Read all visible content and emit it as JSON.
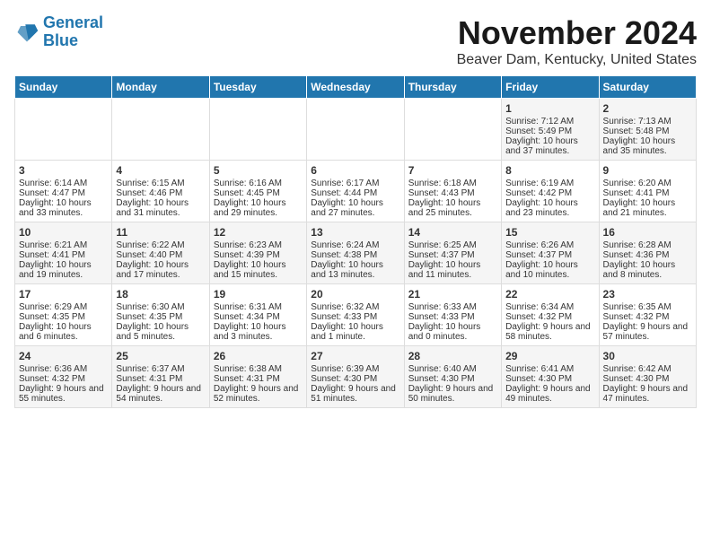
{
  "logo": {
    "line1": "General",
    "line2": "Blue"
  },
  "title": "November 2024",
  "location": "Beaver Dam, Kentucky, United States",
  "days_of_week": [
    "Sunday",
    "Monday",
    "Tuesday",
    "Wednesday",
    "Thursday",
    "Friday",
    "Saturday"
  ],
  "weeks": [
    [
      {
        "day": "",
        "sunrise": "",
        "sunset": "",
        "daylight": ""
      },
      {
        "day": "",
        "sunrise": "",
        "sunset": "",
        "daylight": ""
      },
      {
        "day": "",
        "sunrise": "",
        "sunset": "",
        "daylight": ""
      },
      {
        "day": "",
        "sunrise": "",
        "sunset": "",
        "daylight": ""
      },
      {
        "day": "",
        "sunrise": "",
        "sunset": "",
        "daylight": ""
      },
      {
        "day": "1",
        "sunrise": "Sunrise: 7:12 AM",
        "sunset": "Sunset: 5:49 PM",
        "daylight": "Daylight: 10 hours and 37 minutes."
      },
      {
        "day": "2",
        "sunrise": "Sunrise: 7:13 AM",
        "sunset": "Sunset: 5:48 PM",
        "daylight": "Daylight: 10 hours and 35 minutes."
      }
    ],
    [
      {
        "day": "3",
        "sunrise": "Sunrise: 6:14 AM",
        "sunset": "Sunset: 4:47 PM",
        "daylight": "Daylight: 10 hours and 33 minutes."
      },
      {
        "day": "4",
        "sunrise": "Sunrise: 6:15 AM",
        "sunset": "Sunset: 4:46 PM",
        "daylight": "Daylight: 10 hours and 31 minutes."
      },
      {
        "day": "5",
        "sunrise": "Sunrise: 6:16 AM",
        "sunset": "Sunset: 4:45 PM",
        "daylight": "Daylight: 10 hours and 29 minutes."
      },
      {
        "day": "6",
        "sunrise": "Sunrise: 6:17 AM",
        "sunset": "Sunset: 4:44 PM",
        "daylight": "Daylight: 10 hours and 27 minutes."
      },
      {
        "day": "7",
        "sunrise": "Sunrise: 6:18 AM",
        "sunset": "Sunset: 4:43 PM",
        "daylight": "Daylight: 10 hours and 25 minutes."
      },
      {
        "day": "8",
        "sunrise": "Sunrise: 6:19 AM",
        "sunset": "Sunset: 4:42 PM",
        "daylight": "Daylight: 10 hours and 23 minutes."
      },
      {
        "day": "9",
        "sunrise": "Sunrise: 6:20 AM",
        "sunset": "Sunset: 4:41 PM",
        "daylight": "Daylight: 10 hours and 21 minutes."
      }
    ],
    [
      {
        "day": "10",
        "sunrise": "Sunrise: 6:21 AM",
        "sunset": "Sunset: 4:41 PM",
        "daylight": "Daylight: 10 hours and 19 minutes."
      },
      {
        "day": "11",
        "sunrise": "Sunrise: 6:22 AM",
        "sunset": "Sunset: 4:40 PM",
        "daylight": "Daylight: 10 hours and 17 minutes."
      },
      {
        "day": "12",
        "sunrise": "Sunrise: 6:23 AM",
        "sunset": "Sunset: 4:39 PM",
        "daylight": "Daylight: 10 hours and 15 minutes."
      },
      {
        "day": "13",
        "sunrise": "Sunrise: 6:24 AM",
        "sunset": "Sunset: 4:38 PM",
        "daylight": "Daylight: 10 hours and 13 minutes."
      },
      {
        "day": "14",
        "sunrise": "Sunrise: 6:25 AM",
        "sunset": "Sunset: 4:37 PM",
        "daylight": "Daylight: 10 hours and 11 minutes."
      },
      {
        "day": "15",
        "sunrise": "Sunrise: 6:26 AM",
        "sunset": "Sunset: 4:37 PM",
        "daylight": "Daylight: 10 hours and 10 minutes."
      },
      {
        "day": "16",
        "sunrise": "Sunrise: 6:28 AM",
        "sunset": "Sunset: 4:36 PM",
        "daylight": "Daylight: 10 hours and 8 minutes."
      }
    ],
    [
      {
        "day": "17",
        "sunrise": "Sunrise: 6:29 AM",
        "sunset": "Sunset: 4:35 PM",
        "daylight": "Daylight: 10 hours and 6 minutes."
      },
      {
        "day": "18",
        "sunrise": "Sunrise: 6:30 AM",
        "sunset": "Sunset: 4:35 PM",
        "daylight": "Daylight: 10 hours and 5 minutes."
      },
      {
        "day": "19",
        "sunrise": "Sunrise: 6:31 AM",
        "sunset": "Sunset: 4:34 PM",
        "daylight": "Daylight: 10 hours and 3 minutes."
      },
      {
        "day": "20",
        "sunrise": "Sunrise: 6:32 AM",
        "sunset": "Sunset: 4:33 PM",
        "daylight": "Daylight: 10 hours and 1 minute."
      },
      {
        "day": "21",
        "sunrise": "Sunrise: 6:33 AM",
        "sunset": "Sunset: 4:33 PM",
        "daylight": "Daylight: 10 hours and 0 minutes."
      },
      {
        "day": "22",
        "sunrise": "Sunrise: 6:34 AM",
        "sunset": "Sunset: 4:32 PM",
        "daylight": "Daylight: 9 hours and 58 minutes."
      },
      {
        "day": "23",
        "sunrise": "Sunrise: 6:35 AM",
        "sunset": "Sunset: 4:32 PM",
        "daylight": "Daylight: 9 hours and 57 minutes."
      }
    ],
    [
      {
        "day": "24",
        "sunrise": "Sunrise: 6:36 AM",
        "sunset": "Sunset: 4:32 PM",
        "daylight": "Daylight: 9 hours and 55 minutes."
      },
      {
        "day": "25",
        "sunrise": "Sunrise: 6:37 AM",
        "sunset": "Sunset: 4:31 PM",
        "daylight": "Daylight: 9 hours and 54 minutes."
      },
      {
        "day": "26",
        "sunrise": "Sunrise: 6:38 AM",
        "sunset": "Sunset: 4:31 PM",
        "daylight": "Daylight: 9 hours and 52 minutes."
      },
      {
        "day": "27",
        "sunrise": "Sunrise: 6:39 AM",
        "sunset": "Sunset: 4:30 PM",
        "daylight": "Daylight: 9 hours and 51 minutes."
      },
      {
        "day": "28",
        "sunrise": "Sunrise: 6:40 AM",
        "sunset": "Sunset: 4:30 PM",
        "daylight": "Daylight: 9 hours and 50 minutes."
      },
      {
        "day": "29",
        "sunrise": "Sunrise: 6:41 AM",
        "sunset": "Sunset: 4:30 PM",
        "daylight": "Daylight: 9 hours and 49 minutes."
      },
      {
        "day": "30",
        "sunrise": "Sunrise: 6:42 AM",
        "sunset": "Sunset: 4:30 PM",
        "daylight": "Daylight: 9 hours and 47 minutes."
      }
    ]
  ]
}
